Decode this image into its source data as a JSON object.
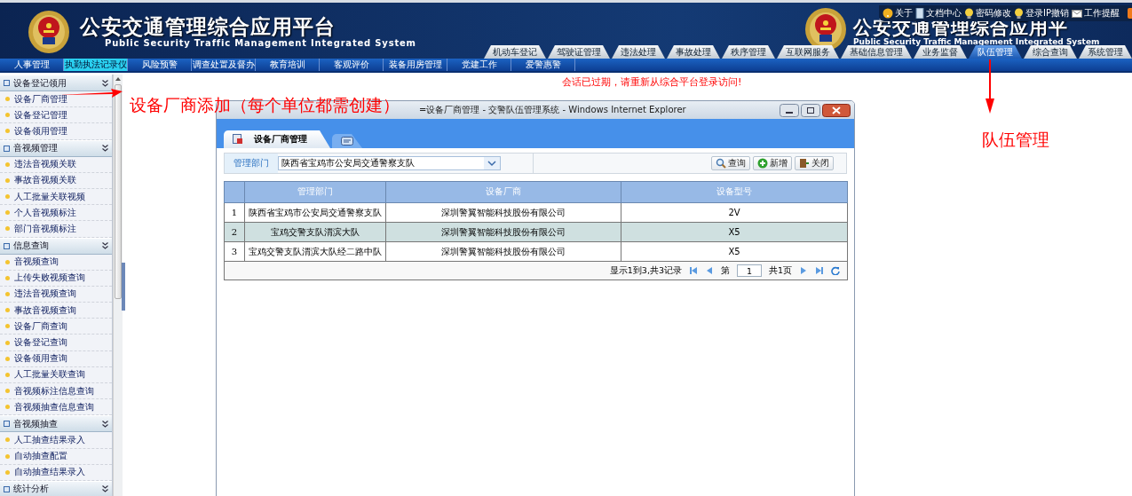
{
  "header": {
    "title": "公安交通管理综合应用平台",
    "subtitle": "Public Security Traffic Management Integrated System",
    "overlay_title": "公安交通管理综合应用平",
    "overlay_subtitle": "Public Security Traffic Management Integrated System"
  },
  "top_links": [
    {
      "label": "关于",
      "kind": "help"
    },
    {
      "label": "文档中心",
      "kind": "doc"
    },
    {
      "label": "密码修改",
      "kind": "bulb"
    },
    {
      "label": "登录IP撤销",
      "kind": "bulb"
    },
    {
      "label": "工作提醒",
      "kind": "mail"
    }
  ],
  "main_tabs": [
    {
      "label": "机动车登记",
      "selected": false
    },
    {
      "label": "驾驶证管理",
      "selected": false
    },
    {
      "label": "违法处理",
      "selected": false
    },
    {
      "label": "事故处理",
      "selected": false
    },
    {
      "label": "秩序管理",
      "selected": false
    },
    {
      "label": "互联网服务",
      "selected": false
    },
    {
      "label": "基础信息管理",
      "selected": false
    },
    {
      "label": "业务监督",
      "selected": false
    },
    {
      "label": "队伍管理",
      "selected": true
    },
    {
      "label": "综合查询",
      "selected": false
    },
    {
      "label": "系统管理",
      "selected": false
    }
  ],
  "sub_tabs": [
    {
      "label": "人事管理",
      "selected": false
    },
    {
      "label": "执勤执法记录仪",
      "selected": true
    },
    {
      "label": "风险预警",
      "selected": false
    },
    {
      "label": "调查处置及督办",
      "selected": false
    },
    {
      "label": "教育培训",
      "selected": false
    },
    {
      "label": "客观评价",
      "selected": false
    },
    {
      "label": "装备用房管理",
      "selected": false
    },
    {
      "label": "党建工作",
      "selected": false
    },
    {
      "label": "爱警惠警",
      "selected": false
    }
  ],
  "sidebar": {
    "groups": [
      {
        "title": "设备登记领用",
        "items": [
          "设备厂商管理",
          "设备登记管理",
          "设备领用管理"
        ]
      },
      {
        "title": "音视频管理",
        "items": [
          "违法音视频关联",
          "事故音视频关联",
          "人工批量关联视频",
          "个人音视频标注",
          "部门音视频标注"
        ]
      },
      {
        "title": "信息查询",
        "items": [
          "音视频查询",
          "上传失败视频查询",
          "违法音视频查询",
          "事故音视频查询",
          "设备厂商查询",
          "设备登记查询",
          "设备领用查询",
          "人工批量关联查询",
          "音视频标注信息查询",
          "音视频抽查信息查询"
        ]
      },
      {
        "title": "音视频抽查",
        "items": [
          "人工抽查结果录入",
          "自动抽查配置",
          "自动抽查结果录入"
        ]
      },
      {
        "title": "统计分析"
      }
    ]
  },
  "session_message": "会话已过期，请重新从综合平台登录访问!",
  "annotations": [
    {
      "text": "设备厂商添加（每个单位都需创建）",
      "kind": "right"
    },
    {
      "text": "队伍管理",
      "kind": "up"
    }
  ],
  "popup": {
    "title": "=设备厂商管理 - 交警队伍管理系统 - Windows Internet Explorer",
    "tabs": [
      {
        "label": "设备厂商管理",
        "selected": true
      },
      {
        "selected": false
      }
    ],
    "filter": {
      "label": "管理部门",
      "value": "陕西省宝鸡市公安局交通警察支队"
    },
    "buttons": [
      {
        "label": "查询",
        "kind": "search"
      },
      {
        "label": "新增",
        "kind": "add"
      },
      {
        "label": "关闭",
        "kind": "close"
      }
    ],
    "table": {
      "columns": [
        "管理部门",
        "设备厂商",
        "设备型号"
      ],
      "rows": [
        {
          "index": "1",
          "cells": [
            "陕西省宝鸡市公安局交通警察支队",
            "深圳警翼智能科技股份有限公司",
            "2V"
          ],
          "selected": false
        },
        {
          "index": "2",
          "cells": [
            "宝鸡交警支队渭滨大队",
            "深圳警翼智能科技股份有限公司",
            "X5"
          ],
          "selected": true
        },
        {
          "index": "3",
          "cells": [
            "宝鸡交警支队渭滨大队经二路中队",
            "深圳警翼智能科技股份有限公司",
            "X5"
          ],
          "selected": false
        }
      ]
    },
    "pager": {
      "summary": "显示1到3,共3记录",
      "page_label": "第",
      "page": "1",
      "total": "共1页"
    }
  }
}
